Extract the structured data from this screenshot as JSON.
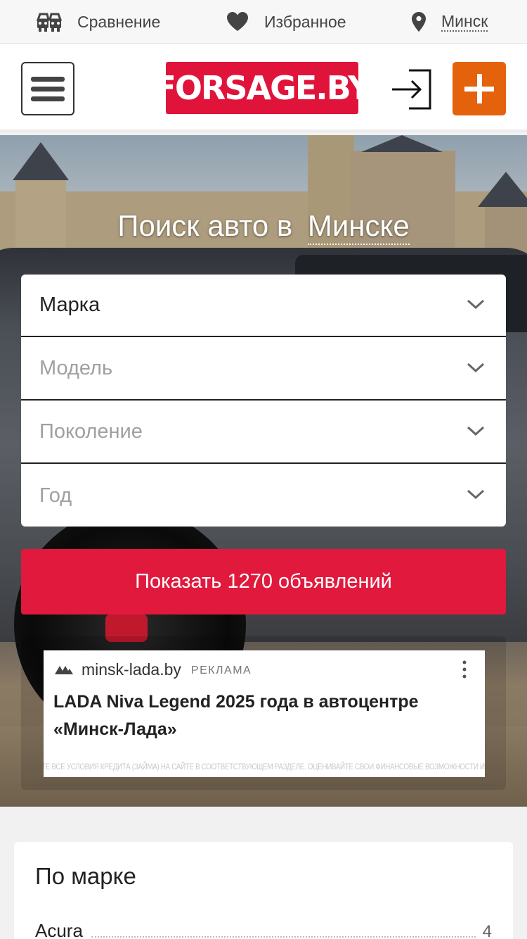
{
  "topbar": {
    "compare_label": "Сравнение",
    "favorites_label": "Избранное",
    "city_label": "Минск"
  },
  "header": {
    "logo_text": "FORSAGE.BY",
    "accent_color": "#e0143b",
    "add_color": "#e4620c"
  },
  "hero": {
    "title": "Поиск авто в",
    "city": "Минске",
    "selects": [
      {
        "label": "Марка",
        "state": "active"
      },
      {
        "label": "Модель",
        "state": "disabled"
      },
      {
        "label": "Поколение",
        "state": "disabled"
      },
      {
        "label": "Год",
        "state": "disabled"
      }
    ],
    "show_button_label": "Показать 1270 объявлений"
  },
  "ad": {
    "domain": "minsk-lada.by",
    "label": "РЕКЛАМА",
    "title": "LADA Niva Legend 2025 года в автоцентре «Минск-Лада»",
    "disclaimer": "ИЗУЧИТЕ ВСЕ УСЛОВИЯ КРЕДИТА (ЗАЙМА) НА САЙТЕ В СООТВЕТСТВУЮЩЕМ РАЗДЕЛЕ. ОЦЕНИВАЙТЕ СВОИ ФИНАНСОВЫЕ ВОЗМОЖНОСТИ И РИСКИ"
  },
  "brands": {
    "title": "По марке",
    "items": [
      {
        "name": "Acura",
        "count": "4"
      }
    ]
  }
}
